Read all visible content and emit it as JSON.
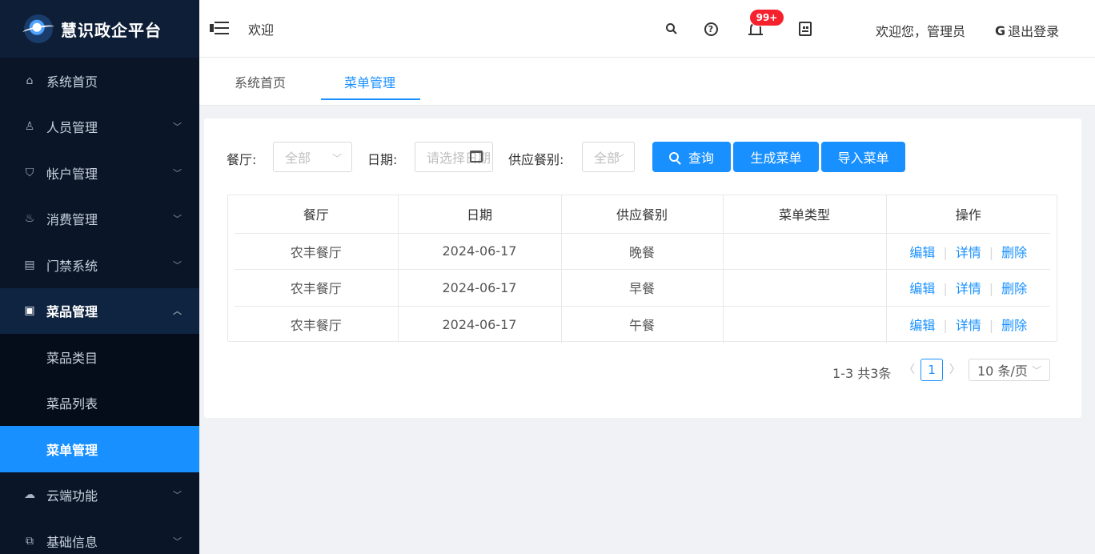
{
  "app": {
    "title": "慧识政企平台"
  },
  "sidebar": {
    "items": [
      {
        "label": "系统首页",
        "icon": "home-icon"
      },
      {
        "label": "人员管理",
        "icon": "users-icon"
      },
      {
        "label": "帐户管理",
        "icon": "shield-icon"
      },
      {
        "label": "消费管理",
        "icon": "cup-icon"
      },
      {
        "label": "门禁系统",
        "icon": "door-icon"
      },
      {
        "label": "菜品管理",
        "icon": "document-search-icon"
      },
      {
        "label": "云端功能",
        "icon": "cloud-icon"
      },
      {
        "label": "基础信息",
        "icon": "layers-icon"
      }
    ],
    "submenu": [
      {
        "label": "菜品类目"
      },
      {
        "label": "菜品列表"
      },
      {
        "label": "菜单管理"
      }
    ]
  },
  "header": {
    "title": "欢迎",
    "badge": "99+",
    "welcome": "欢迎您，管理员",
    "logout": "退出登录"
  },
  "tabs": [
    {
      "label": "系统首页"
    },
    {
      "label": "菜单管理"
    }
  ],
  "filters": {
    "restaurant_label": "餐厅:",
    "restaurant_value": "全部",
    "date_label": "日期:",
    "date_placeholder": "请选择日期",
    "meal_label": "供应餐别:",
    "meal_value": "全部"
  },
  "buttons": {
    "query": "查询",
    "generate": "生成菜单",
    "import": "导入菜单"
  },
  "table": {
    "columns": [
      "餐厅",
      "日期",
      "供应餐别",
      "菜单类型",
      "操作"
    ],
    "rows": [
      {
        "restaurant": "农丰餐厅",
        "date": "2024-06-17",
        "meal": "晚餐",
        "type": ""
      },
      {
        "restaurant": "农丰餐厅",
        "date": "2024-06-17",
        "meal": "早餐",
        "type": ""
      },
      {
        "restaurant": "农丰餐厅",
        "date": "2024-06-17",
        "meal": "午餐",
        "type": ""
      }
    ],
    "actions": {
      "edit": "编辑",
      "detail": "详情",
      "delete": "删除"
    }
  },
  "pagination": {
    "total": "1-3 共3条",
    "current": "1",
    "page_size": "10 条/页"
  },
  "colors": {
    "accent": "#1890ff",
    "sidebar_bg": "#0a1628",
    "badge": "#f5222d"
  }
}
